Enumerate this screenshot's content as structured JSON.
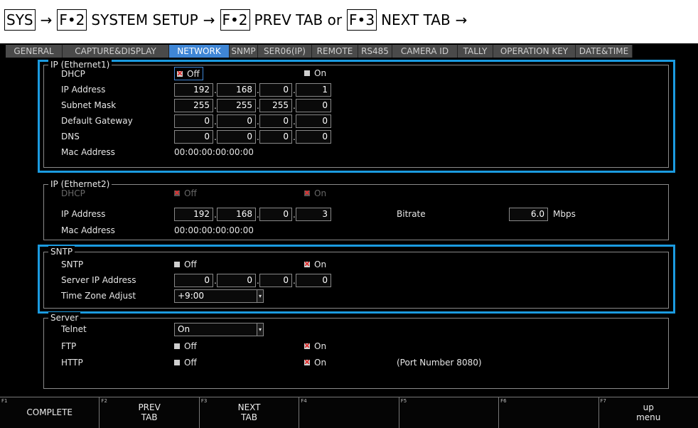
{
  "breadcrumb": {
    "sys": "SYS",
    "arrow": "→",
    "key1": "F•2",
    "system_setup": "SYSTEM SETUP",
    "key2": "F•2",
    "prev_tab": "PREV TAB or",
    "key3": "F•3",
    "next_tab": "NEXT TAB"
  },
  "tabs": [
    "GENERAL",
    "CAPTURE&DISPLAY",
    "NETWORK",
    "SNMP",
    "SER06(IP)",
    "REMOTE",
    "RS485",
    "CAMERA ID",
    "TALLY",
    "OPERATION KEY",
    "DATE&TIME"
  ],
  "active_tab": "NETWORK",
  "eth1": {
    "title": "IP (Ethernet1)",
    "dhcp_label": "DHCP",
    "dhcp_off": "Off",
    "dhcp_on": "On",
    "ip_label": "IP Address",
    "ip": [
      "192",
      "168",
      "0",
      "1"
    ],
    "subnet_label": "Subnet Mask",
    "subnet": [
      "255",
      "255",
      "255",
      "0"
    ],
    "gateway_label": "Default Gateway",
    "gateway": [
      "0",
      "0",
      "0",
      "0"
    ],
    "dns_label": "DNS",
    "dns": [
      "0",
      "0",
      "0",
      "0"
    ],
    "mac_label": "Mac Address",
    "mac": "00:00:00:00:00:00"
  },
  "eth2": {
    "title": "IP (Ethernet2)",
    "dhcp_label": "DHCP",
    "dhcp_off": "Off",
    "dhcp_on": "On",
    "ip_label": "IP Address",
    "ip": [
      "192",
      "168",
      "0",
      "3"
    ],
    "bitrate_label": "Bitrate",
    "bitrate": "6.0",
    "bitrate_unit": "Mbps",
    "mac_label": "Mac Address",
    "mac": "00:00:00:00:00:00"
  },
  "sntp": {
    "title": "SNTP",
    "sntp_label": "SNTP",
    "off": "Off",
    "on": "On",
    "server_label": "Server IP Address",
    "server": [
      "0",
      "0",
      "0",
      "0"
    ],
    "tz_label": "Time Zone Adjust",
    "tz": "+9:00"
  },
  "server": {
    "title": "Server",
    "telnet_label": "Telnet",
    "telnet": "On",
    "ftp_label": "FTP",
    "http_label": "HTTP",
    "off": "Off",
    "on": "On",
    "port_note": "(Port Number 8080)"
  },
  "fkeys": [
    {
      "num": "F1",
      "label": "COMPLETE"
    },
    {
      "num": "F2",
      "label": "PREV\nTAB"
    },
    {
      "num": "F3",
      "label": "NEXT\nTAB"
    },
    {
      "num": "F4",
      "label": ""
    },
    {
      "num": "F5",
      "label": ""
    },
    {
      "num": "F6",
      "label": ""
    },
    {
      "num": "F7",
      "label": "up\nmenu"
    }
  ],
  "colors": {
    "highlight": "#1b9be0",
    "active_tab": "#3f86d6",
    "check_mark": "#e03030"
  }
}
